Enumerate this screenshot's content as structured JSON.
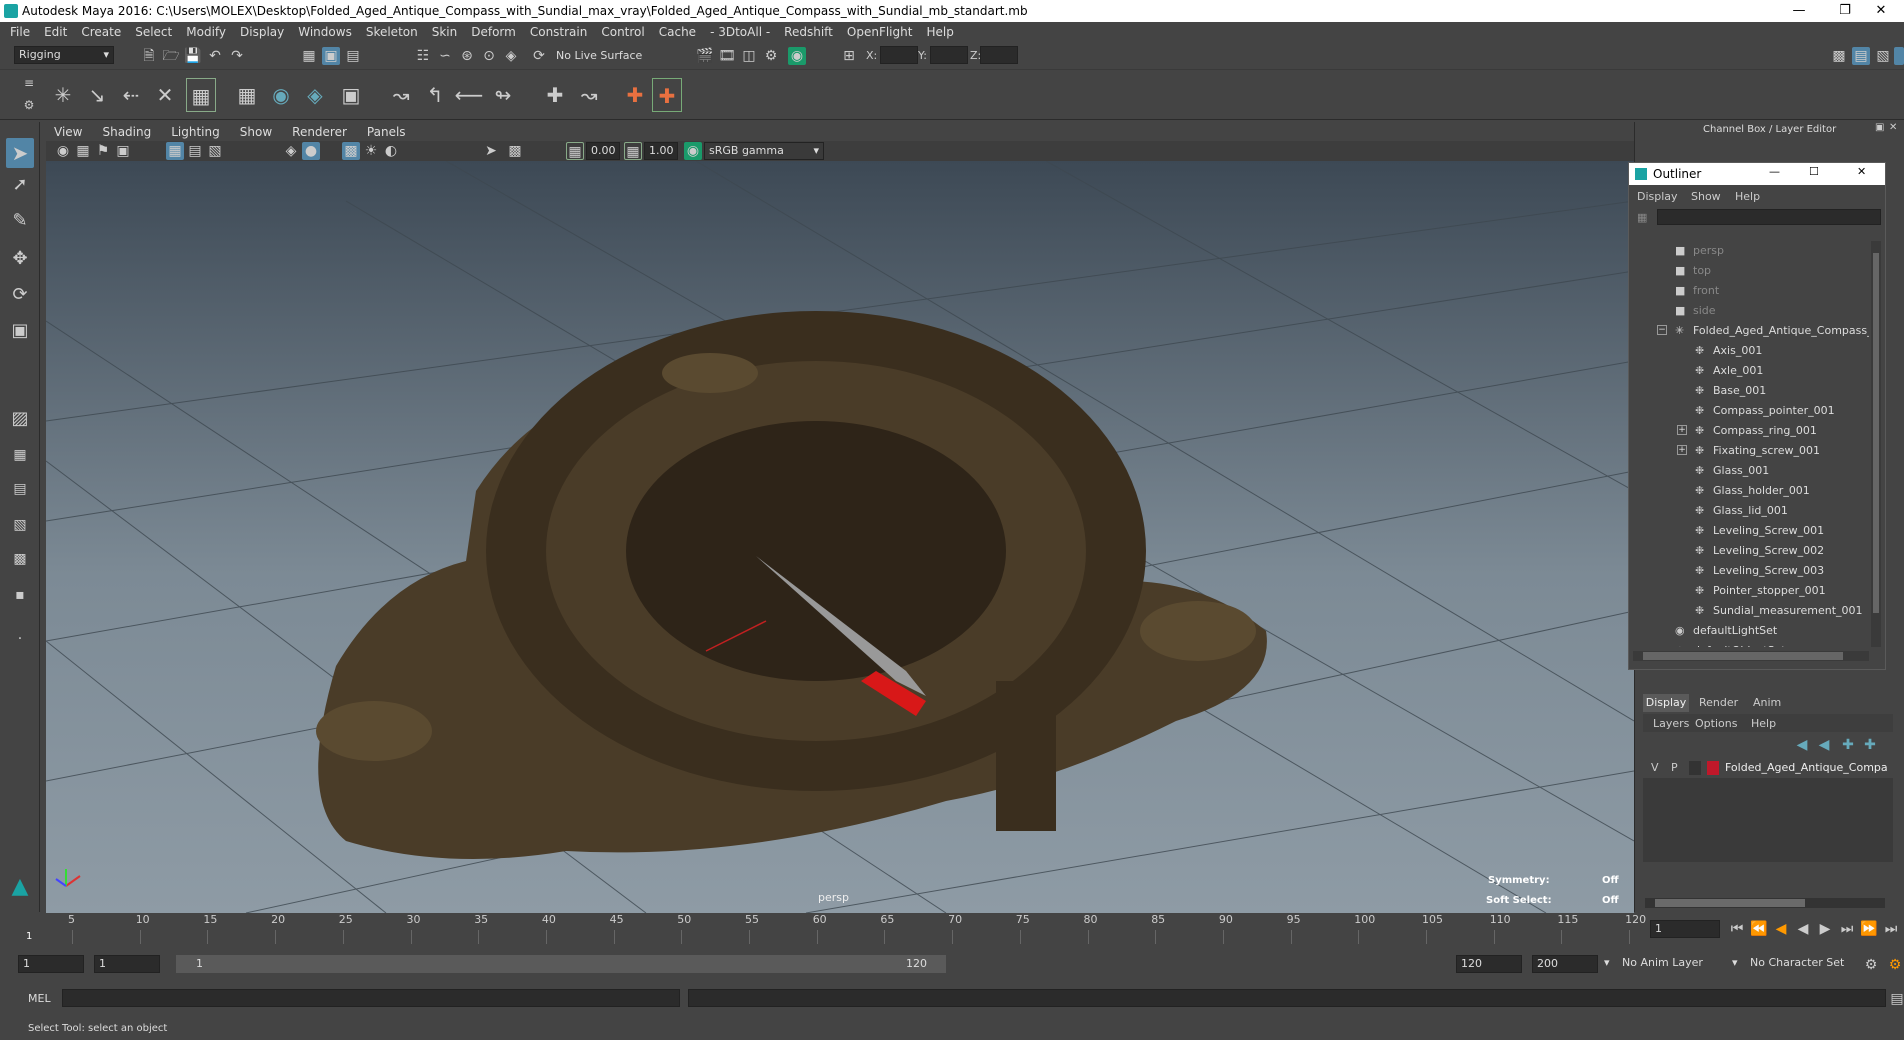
{
  "window": {
    "title": "Autodesk Maya 2016: C:\\Users\\MOLEX\\Desktop\\Folded_Aged_Antique_Compass_with_Sundial_max_vray\\Folded_Aged_Antique_Compass_with_Sundial_mb_standart.mb",
    "minimize_icon": "minimize-icon",
    "restore_icon": "restore-icon",
    "close_icon": "close-icon"
  },
  "menubar": [
    "File",
    "Edit",
    "Create",
    "Select",
    "Modify",
    "Display",
    "Windows",
    "Skeleton",
    "Skin",
    "Deform",
    "Constrain",
    "Control",
    "Cache",
    "- 3DtoAll -",
    "Redshift",
    "OpenFlight",
    "Help"
  ],
  "shelf": {
    "menu_set": "Rigging",
    "live_surface": "No Live Surface",
    "x_label": "X:",
    "y_label": "Y:",
    "z_label": "Z:"
  },
  "viewport": {
    "menu": [
      "View",
      "Shading",
      "Lighting",
      "Show",
      "Renderer",
      "Panels"
    ],
    "exposure": "0.00",
    "gamma": "1.00",
    "color_space": "sRGB gamma",
    "camera_label": "persp",
    "symmetry_label": "Symmetry:",
    "symmetry_value": "Off",
    "soft_select_label": "Soft Select:",
    "soft_select_value": "Off"
  },
  "channel_box": {
    "title": "Channel Box / Layer Editor"
  },
  "outliner": {
    "title": "Outliner",
    "menu": [
      "Display",
      "Show",
      "Help"
    ],
    "cameras": [
      "persp",
      "top",
      "front",
      "side"
    ],
    "group": "Folded_Aged_Antique_Compass_w",
    "children": [
      "Axis_001",
      "Axle_001",
      "Base_001",
      "Compass_pointer_001",
      "Compass_ring_001",
      "Fixating_screw_001",
      "Glass_001",
      "Glass_holder_001",
      "Glass_lid_001",
      "Leveling_Screw_001",
      "Leveling_Screw_002",
      "Leveling_Screw_003",
      "Pointer_stopper_001",
      "Sundial_measurement_001"
    ],
    "sets": [
      "defaultLightSet",
      "defaultObjectSet"
    ]
  },
  "layer_editor": {
    "tabs": [
      "Display",
      "Render",
      "Anim"
    ],
    "menu": [
      "Layers",
      "Options",
      "Help"
    ],
    "layer_v": "V",
    "layer_p": "P",
    "layer_name": "Folded_Aged_Antique_Compa",
    "layer_color": "#c0182a"
  },
  "timeline": {
    "ticks": [
      "5",
      "10",
      "15",
      "20",
      "25",
      "30",
      "35",
      "40",
      "45",
      "50",
      "55",
      "60",
      "65",
      "70",
      "75",
      "80",
      "85",
      "90",
      "95",
      "100",
      "105",
      "110",
      "115",
      "120"
    ],
    "start_marker": "1",
    "current_frame": "1"
  },
  "range": {
    "start": "1",
    "playback_start": "1",
    "slider_start": "1",
    "slider_end": "120",
    "playback_end": "120",
    "end": "200",
    "anim_layer": "No Anim Layer",
    "character_set": "No Character Set"
  },
  "mel": {
    "label": "MEL"
  },
  "status": "Select Tool: select an object"
}
